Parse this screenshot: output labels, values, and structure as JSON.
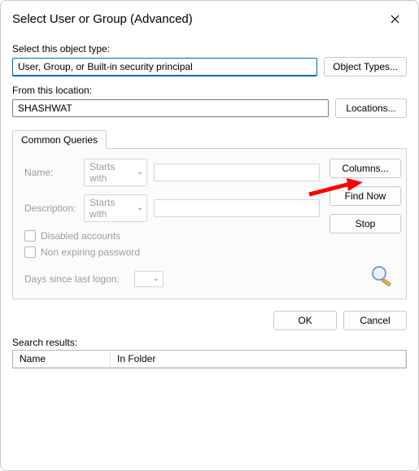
{
  "title": "Select User or Group (Advanced)",
  "object_type": {
    "label": "Select this object type:",
    "value": "User, Group, or Built-in security principal",
    "button": "Object Types..."
  },
  "location": {
    "label": "From this location:",
    "value": "SHASHWAT",
    "button": "Locations..."
  },
  "tab_label": "Common Queries",
  "queries": {
    "name_label": "Name:",
    "name_mode": "Starts with",
    "desc_label": "Description:",
    "desc_mode": "Starts with",
    "disabled_label": "Disabled accounts",
    "nonexpire_label": "Non expiring password",
    "days_label": "Days since last logon:"
  },
  "side_buttons": {
    "columns": "Columns...",
    "find_now": "Find Now",
    "stop": "Stop"
  },
  "bottom": {
    "ok": "OK",
    "cancel": "Cancel"
  },
  "results": {
    "label": "Search results:",
    "col_name": "Name",
    "col_folder": "In Folder"
  }
}
